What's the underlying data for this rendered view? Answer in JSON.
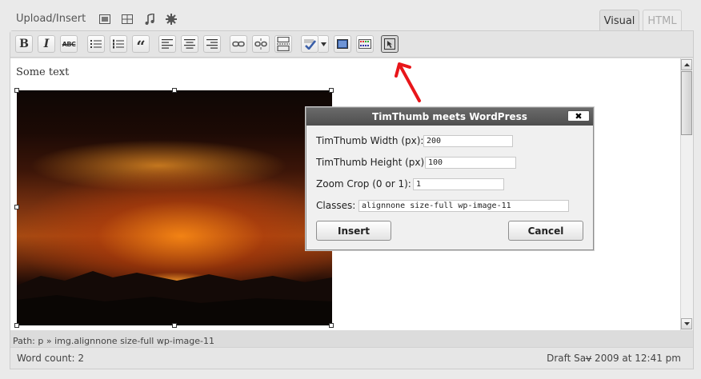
{
  "media_bar": {
    "label": "Upload/Insert",
    "icons": [
      "image-icon",
      "video-icon",
      "audio-icon",
      "media-icon"
    ]
  },
  "tabs": [
    {
      "label": "Visual",
      "active": true
    },
    {
      "label": "HTML",
      "active": false
    }
  ],
  "toolbar": {
    "bold": "B",
    "italic": "I",
    "strikethrough": "ABC",
    "blockquote": "“",
    "buttons": [
      "bold-button",
      "italic-button",
      "strikethrough-button",
      "unordered-list-button",
      "ordered-list-button",
      "blockquote-button",
      "align-left-button",
      "align-center-button",
      "align-right-button",
      "insert-link-button",
      "unlink-button",
      "insert-more-button",
      "spellcheck-button",
      "fullscreen-button",
      "kitchen-sink-button",
      "timthumb-button"
    ]
  },
  "editor": {
    "text": "Some text",
    "path": "Path: p » img.alignnone size-full wp-image-11"
  },
  "status": {
    "word_count": "Word count: 2",
    "draft_saved": "Draft Sav̶ 2009 at 12:41 pm"
  },
  "dialog": {
    "title": "TimThumb meets WordPress",
    "close_label": "✖",
    "fields": [
      {
        "label": "TimThumb Width (px):",
        "value": "200"
      },
      {
        "label": "TimThumb Height (px):",
        "value": "100"
      },
      {
        "label": "Zoom Crop (0 or 1):",
        "value": "1"
      },
      {
        "label": "Classes:",
        "value": "alignnone size-full wp-image-11"
      }
    ],
    "insert_label": "Insert",
    "cancel_label": "Cancel"
  },
  "colors": {
    "annotation_arrow": "#e8161a",
    "dialog_title_bg": "#555555"
  }
}
